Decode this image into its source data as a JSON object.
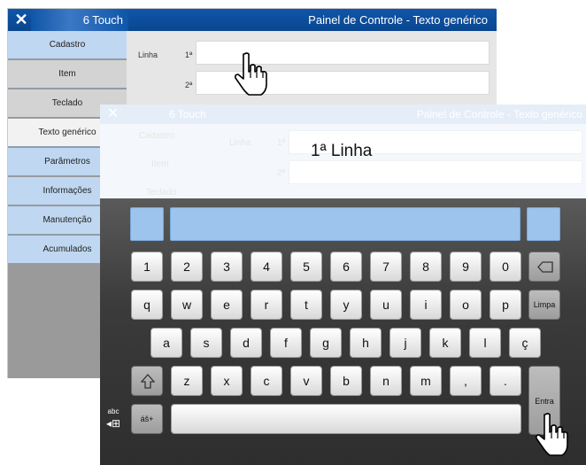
{
  "back_window": {
    "close_glyph": "✕",
    "app_title": "6 Touch",
    "window_title": "Painel de Controle - Texto genérico",
    "sidebar": [
      {
        "label": "Cadastro",
        "style": "blue"
      },
      {
        "label": "Item",
        "style": "gray"
      },
      {
        "label": "Teclado",
        "style": "gray"
      },
      {
        "label": "Texto genérico",
        "style": "white"
      },
      {
        "label": "Parâmetros",
        "style": "blue"
      },
      {
        "label": "Informações",
        "style": "blue"
      },
      {
        "label": "Manutenção",
        "style": "blue"
      },
      {
        "label": "Acumulados",
        "style": "blue"
      }
    ],
    "line_label": "Linha",
    "line1_num": "1ª",
    "line2_num": "2ª"
  },
  "front_window": {
    "close_glyph": "✕",
    "app_title": "6 Touch",
    "window_title": "Painel de Controle - Texto genérico",
    "ghost_sidebar": [
      "Cadastro",
      "Item",
      "Teclado"
    ],
    "ghost_line_label": "Linha",
    "ghost_line1_num": "1ª",
    "ghost_line2_num": "2ª",
    "edit_value": "1ª Linha"
  },
  "keyboard": {
    "row1": [
      "1",
      "2",
      "3",
      "4",
      "5",
      "6",
      "7",
      "8",
      "9",
      "0"
    ],
    "row2": [
      "q",
      "w",
      "e",
      "r",
      "t",
      "y",
      "u",
      "i",
      "o",
      "p"
    ],
    "row3": [
      "a",
      "s",
      "d",
      "f",
      "g",
      "h",
      "j",
      "k",
      "l",
      "ç"
    ],
    "row4": [
      "z",
      "x",
      "c",
      "v",
      "b",
      "n",
      "m",
      ",",
      "."
    ],
    "backspace_icon": "backspace-icon",
    "clear_label": "Limpa",
    "enter_label": "Entra",
    "symbols_label": "áš+",
    "abc_label": "abc",
    "layout_icon": "◂⊞"
  },
  "colors": {
    "titlebar_blue": "#0f56a8",
    "sidebar_blue": "#bfd7f0",
    "nav_blue": "#9cc4ec"
  }
}
